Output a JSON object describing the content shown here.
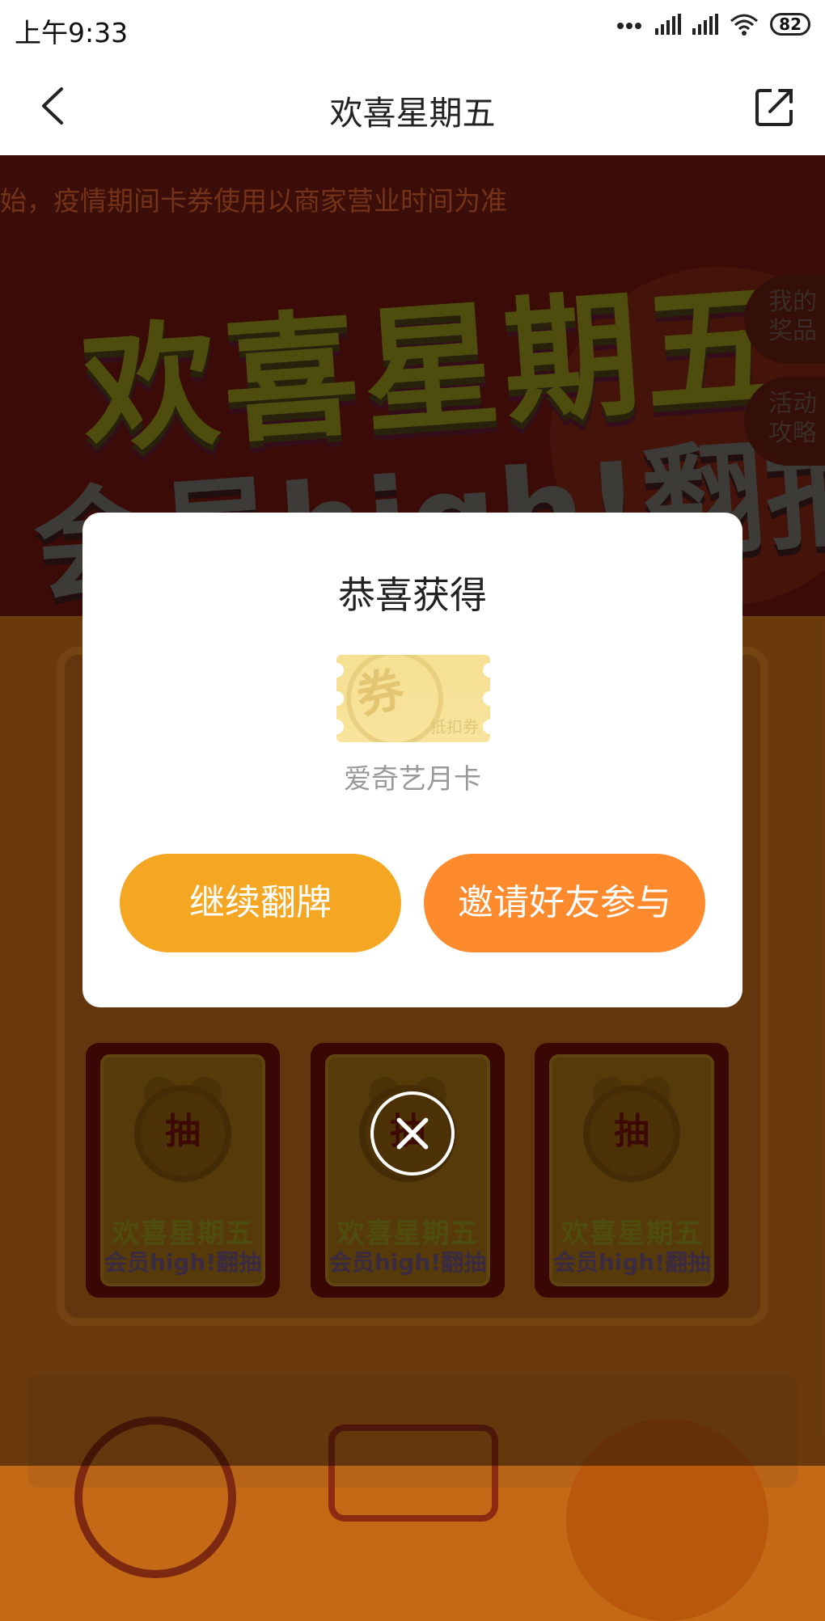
{
  "status_bar": {
    "time": "上午9:33",
    "battery": "82"
  },
  "header": {
    "title": "欢喜星期五"
  },
  "marquee": {
    "text": "始，疫情期间卡券使用以商家营业时间为准"
  },
  "hero": {
    "headline": "欢喜星期五",
    "subline": "会员high!翻抽"
  },
  "side_buttons": [
    {
      "label": "我的\n奖品"
    },
    {
      "label": "活动\n攻略"
    }
  ],
  "cards": [
    {
      "coin": "抽",
      "line1": "欢喜星期五",
      "line2": "会员high!翻抽"
    },
    {
      "coin": "抽",
      "line1": "欢喜星期五",
      "line2": "会员high!翻抽"
    },
    {
      "coin": "抽",
      "line1": "欢喜星期五",
      "line2": "会员high!翻抽"
    }
  ],
  "modal": {
    "heading": "恭喜获得",
    "ticket_seal": "券",
    "ticket_tag": "抵扣券",
    "prize_name": "爱奇艺月卡",
    "continue_label": "继续翻牌",
    "invite_label": "邀请好友参与"
  },
  "colors": {
    "continue_button": "#f5a623",
    "invite_button": "#fd8a2c"
  }
}
